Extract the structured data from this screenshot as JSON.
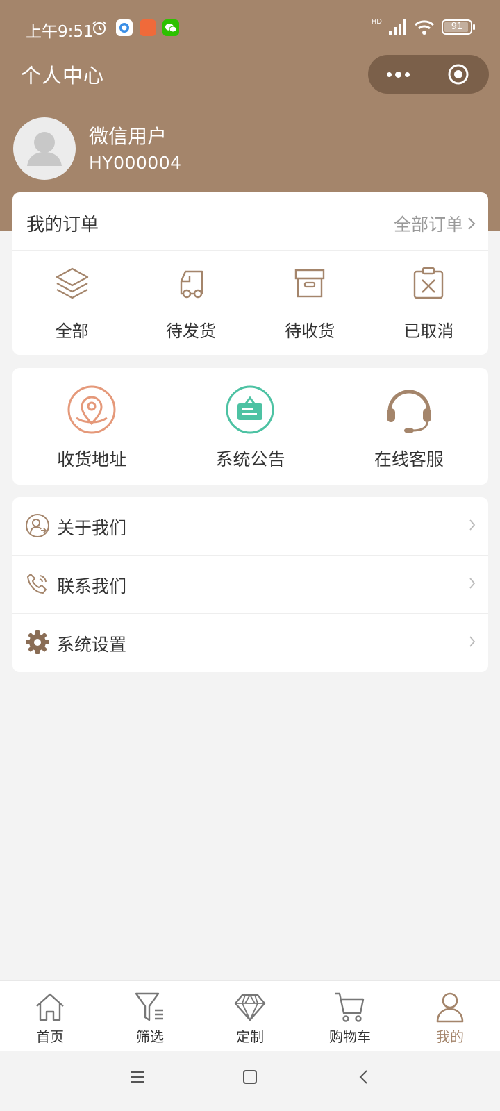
{
  "status_bar": {
    "time": "上午9:51",
    "battery": "91",
    "signal": "HD"
  },
  "header": {
    "title": "个人中心"
  },
  "profile": {
    "name": "微信用户",
    "id": "HY000004"
  },
  "orders": {
    "title": "我的订单",
    "all_label": "全部订单",
    "items": [
      {
        "label": "全部",
        "icon": "layers-icon"
      },
      {
        "label": "待发货",
        "icon": "truck-icon"
      },
      {
        "label": "待收货",
        "icon": "box-icon"
      },
      {
        "label": "已取消",
        "icon": "clipboard-x-icon"
      }
    ]
  },
  "services": [
    {
      "label": "收货地址",
      "icon": "location-pin-icon",
      "color": "#e5997a"
    },
    {
      "label": "系统公告",
      "icon": "announcement-icon",
      "color": "#4dc2a3"
    },
    {
      "label": "在线客服",
      "icon": "headset-icon",
      "color": "#a4856b"
    }
  ],
  "menu": [
    {
      "label": "关于我们",
      "icon": "user-info-icon"
    },
    {
      "label": "联系我们",
      "icon": "phone-icon"
    },
    {
      "label": "系统设置",
      "icon": "gear-icon"
    }
  ],
  "tabbar": [
    {
      "label": "首页",
      "icon": "home-icon",
      "active": false
    },
    {
      "label": "筛选",
      "icon": "filter-icon",
      "active": false
    },
    {
      "label": "定制",
      "icon": "diamond-icon",
      "active": false
    },
    {
      "label": "购物车",
      "icon": "cart-icon",
      "active": false
    },
    {
      "label": "我的",
      "icon": "person-icon",
      "active": true
    }
  ],
  "colors": {
    "brand": "#a4856b",
    "background": "#f3f3f3"
  }
}
